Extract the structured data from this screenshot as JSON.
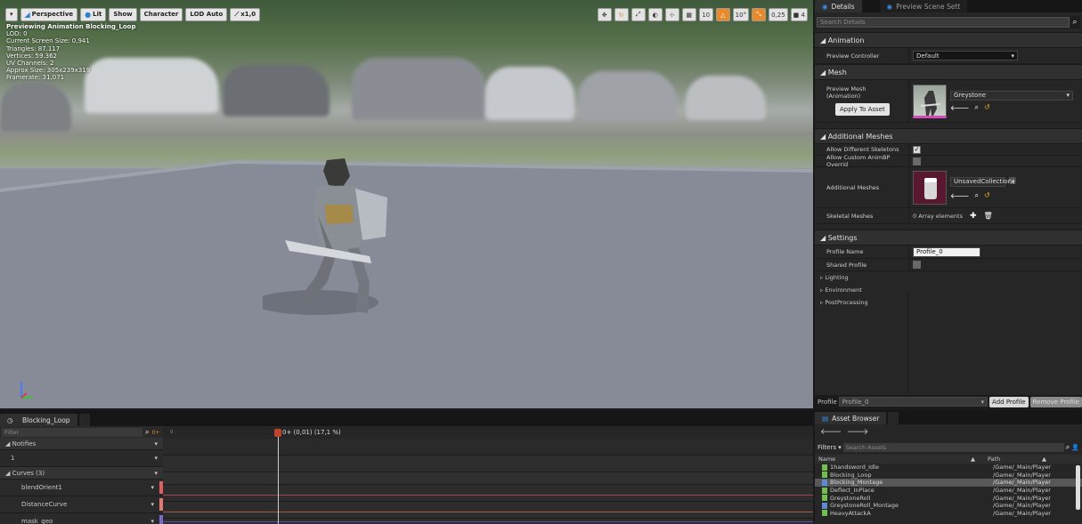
{
  "viewport": {
    "toolbar": {
      "menu_icon": "chevron-down-icon",
      "perspective": "Perspective",
      "lit": "Lit",
      "show": "Show",
      "character": "Character",
      "lod": "LOD Auto",
      "speed": "x1,0"
    },
    "right_tools": {
      "grid_snap": "10",
      "rotate_snap": "10°",
      "scale_snap": "0,25",
      "camera_speed": "4"
    },
    "stats": {
      "preview": "Previewing Animation Blocking_Loop",
      "lod": "LOD: 0",
      "screen_size": "Current Screen Size: 0,941",
      "triangles": "Triangles: 87.117",
      "vertices": "Vertices: 59.362",
      "uv_channels": "UV Channels: 2",
      "approx_size": "Approx Size: 305x239x319",
      "framerate": "Framerate: 31,071"
    }
  },
  "details": {
    "tabs": [
      "Details",
      "Preview Scene Sett"
    ],
    "search_placeholder": "Search Details",
    "animation": {
      "header": "Animation",
      "preview_controller_label": "Preview Controller",
      "preview_controller_value": "Default"
    },
    "mesh": {
      "header": "Mesh",
      "preview_mesh_label": "Preview Mesh (Animation)",
      "preview_mesh_value": "Greystone",
      "apply_button": "Apply To Asset"
    },
    "additional_meshes": {
      "header": "Additional Meshes",
      "allow_diff_label": "Allow Different Skeletons",
      "allow_custom_label": "Allow Custom AnimBP Overrid",
      "additional_label": "Additional Meshes",
      "additional_value": "UnsavedCollection",
      "skeletal_label": "Skeletal Meshes",
      "skeletal_value": "0 Array elements"
    },
    "settings": {
      "header": "Settings",
      "profile_name_label": "Profile Name",
      "profile_name_value": "Profile_0",
      "shared_label": "Shared Profile",
      "lighting": "Lighting",
      "environment": "Environment",
      "postprocessing": "PostProcessing"
    },
    "profile_bar": {
      "label": "Profile",
      "value": "Profile_0",
      "add": "Add Profile",
      "remove": "Remove Profile"
    }
  },
  "timeline": {
    "tab": "Blocking_Loop",
    "filter_placeholder": "Filter",
    "notifies": "Notifies",
    "notify_track": "1",
    "curves": "Curves",
    "curves_count": "(3)",
    "curve_names": [
      "blendOrient1",
      "DistanceCurve",
      "mask_geo"
    ],
    "scrubber": "0+ (0,01) (17,1 %)",
    "start_frame": "0"
  },
  "asset_browser": {
    "tab": "Asset Browser",
    "filters": "Filters",
    "search_placeholder": "Search Assets",
    "col_name": "Name",
    "col_path": "Path",
    "items": [
      {
        "name": "1handsword_Idle",
        "path": "/Game/_Main/Player"
      },
      {
        "name": "Blocking_Loop",
        "path": "/Game/_Main/Player"
      },
      {
        "name": "Blocking_Montage",
        "path": "/Game/_Main/Player"
      },
      {
        "name": "Deflect_InPlace",
        "path": "/Game/_Main/Player"
      },
      {
        "name": "GreystoneRoll",
        "path": "/Game/_Main/Player"
      },
      {
        "name": "GreystoneRoll_Montage",
        "path": "/Game/_Main/Player"
      },
      {
        "name": "HeavyAttackA",
        "path": "/Game/_Main/Player"
      }
    ]
  },
  "colors": {
    "accent_blue": "#2d7fd1",
    "orange": "#e88a2a",
    "scrubber": "#c0442a",
    "curve1": "#e06060",
    "curve2": "#e07a70",
    "curve3": "#7a6ad0"
  }
}
